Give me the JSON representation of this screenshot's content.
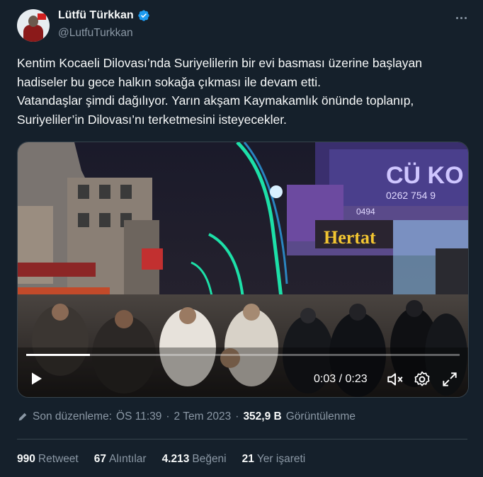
{
  "author": {
    "display_name": "Lütfü Türkkan",
    "handle": "@LutfuTurkkan",
    "verified_icon": "verified-badge-icon",
    "verified_color": "#1d9bf0"
  },
  "tweet": {
    "lines": [
      "Kentim Kocaeli Dilovası’nda Suriyelilerin bir evi basması üzerine başlayan",
      "hadiseler bu gece halkın sokağa çıkması ile devam etti.",
      "Vatandaşlar şimdi dağılıyor. Yarın akşam Kaymakamlık önünde toplanıp,",
      "Suriyeliler’in Dilovası’nı terketmesini isteyecekler."
    ]
  },
  "video": {
    "time_readout": "0:03 / 0:23",
    "progress_fraction": 0.147,
    "shop_sign": "Hertat",
    "phone_sign": "0262 754 9",
    "phone_sign2": "0494",
    "top_sign": "CÜ KO",
    "play_icon": "play-icon",
    "mute_icon": "volume-muted-icon",
    "settings_icon": "settings-gear-icon",
    "fullscreen_icon": "fullscreen-icon"
  },
  "meta": {
    "edit_icon": "pencil-icon",
    "edited_label": "Son düzenleme:",
    "time": "ÖS 11:39",
    "separator": "·",
    "date": "2 Tem 2023",
    "views_count": "352,9 B",
    "views_label": "Görüntülenme"
  },
  "stats": [
    {
      "count": "990",
      "label": "Retweet"
    },
    {
      "count": "67",
      "label": "Alıntılar"
    },
    {
      "count": "4.213",
      "label": "Beğeni"
    },
    {
      "count": "21",
      "label": "Yer işareti"
    }
  ],
  "colors": {
    "background": "#15202b",
    "text_primary": "#f7f9f9",
    "text_secondary": "#8b98a5",
    "border": "#38444d"
  }
}
